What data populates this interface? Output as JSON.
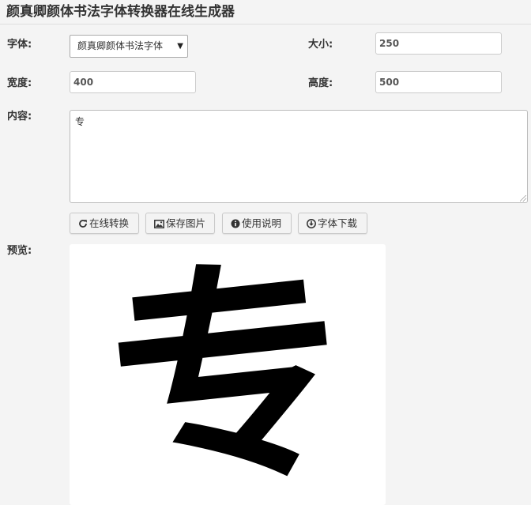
{
  "page": {
    "title": "颜真卿颜体书法字体转换器在线生成器"
  },
  "form": {
    "font_label": "字体:",
    "font_selected": "颜真卿颜体书法字体",
    "size_label": "大小:",
    "size_value": "250",
    "width_label": "宽度:",
    "width_value": "400",
    "height_label": "高度:",
    "height_value": "500",
    "content_label": "内容:",
    "content_value": "专",
    "preview_label": "预览:"
  },
  "buttons": {
    "convert": "在线转换",
    "save": "保存图片",
    "help": "使用说明",
    "download": "字体下载"
  },
  "preview": {
    "text": "专"
  },
  "icons": [
    "refresh-icon",
    "image-icon",
    "info-icon",
    "download-icon",
    "chevron-down-icon"
  ]
}
